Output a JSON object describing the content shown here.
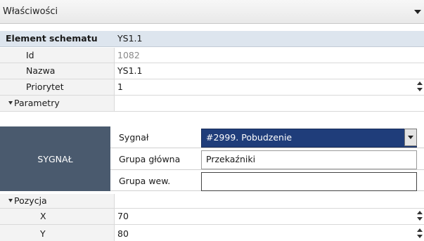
{
  "panel": {
    "title": "Właściwości"
  },
  "header": {
    "label": "Element schematu",
    "value": "YS1.1"
  },
  "rows": {
    "id": {
      "label": "Id",
      "value": "1082"
    },
    "nazwa": {
      "label": "Nazwa",
      "value": "YS1.1"
    },
    "priorytet": {
      "label": "Priorytet",
      "value": "1"
    }
  },
  "parametry": {
    "label": "Parametry"
  },
  "sygnal": {
    "block_label": "SYGNAŁ",
    "sygnal_label": "Sygnał",
    "sygnal_value": "#2999. Pobudzenie",
    "grupa_glowna_label": "Grupa główna",
    "grupa_glowna_value": "Przekaźniki",
    "grupa_wew_label": "Grupa wew.",
    "grupa_wew_value": ""
  },
  "pozycja": {
    "label": "Pozycja",
    "x_label": "X",
    "x_value": "70",
    "y_label": "Y",
    "y_value": "80"
  }
}
